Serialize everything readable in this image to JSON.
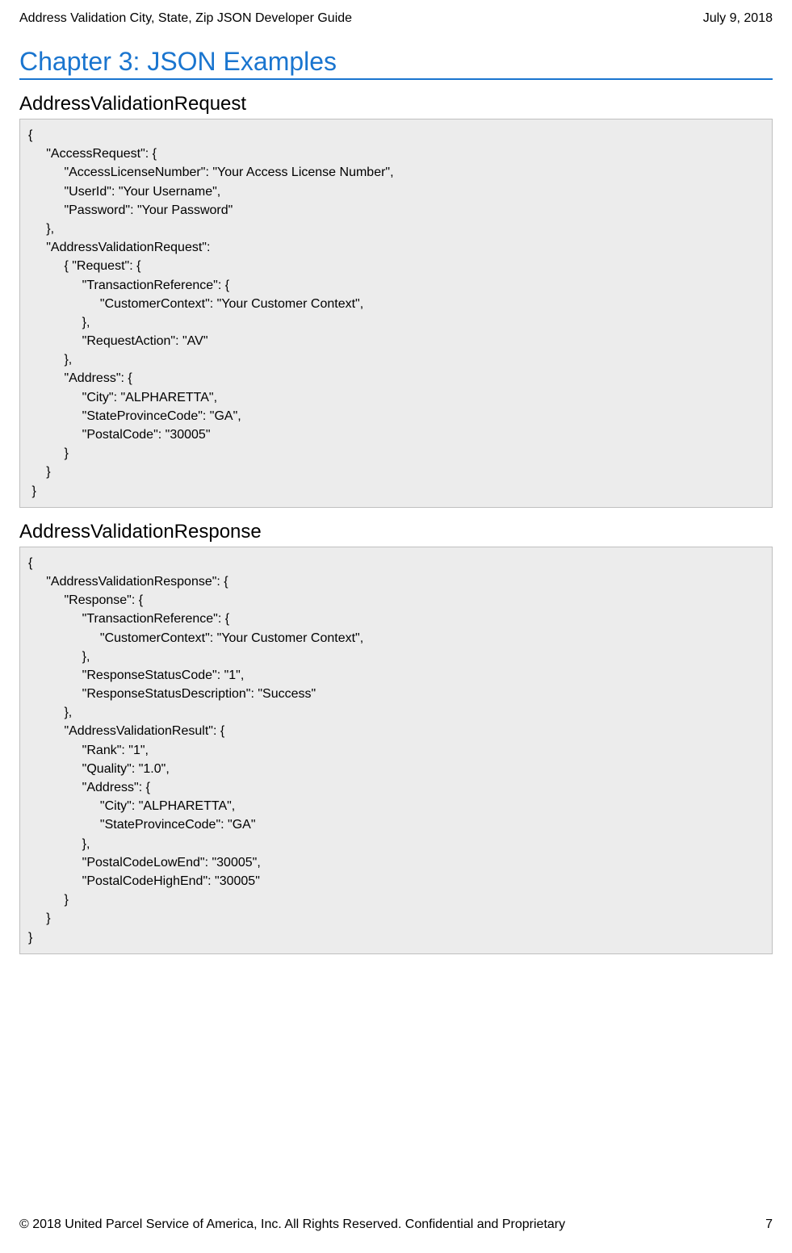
{
  "header": {
    "left": "Address Validation City, State, Zip JSON Developer Guide",
    "right": "July 9, 2018"
  },
  "chapter_title": "Chapter 3: JSON Examples",
  "section1_title": "AddressValidationRequest",
  "section2_title": "AddressValidationResponse",
  "code1": "{\n     \"AccessRequest\": {\n          \"AccessLicenseNumber\": \"Your Access License Number\",\n          \"UserId\": \"Your Username\",\n          \"Password\": \"Your Password\"\n     },\n     \"AddressValidationRequest\":\n          { \"Request\": {\n               \"TransactionReference\": {\n                    \"CustomerContext\": \"Your Customer Context\",\n               },\n               \"RequestAction\": \"AV\"\n          },\n          \"Address\": {\n               \"City\": \"ALPHARETTA\",\n               \"StateProvinceCode\": \"GA\",\n               \"PostalCode\": \"30005\"\n          }\n     }\n }",
  "code2": "{\n     \"AddressValidationResponse\": {\n          \"Response\": {\n               \"TransactionReference\": {\n                    \"CustomerContext\": \"Your Customer Context\",\n               },\n               \"ResponseStatusCode\": \"1\",\n               \"ResponseStatusDescription\": \"Success\"\n          },\n          \"AddressValidationResult\": {\n               \"Rank\": \"1\",\n               \"Quality\": \"1.0\",\n               \"Address\": {\n                    \"City\": \"ALPHARETTA\",\n                    \"StateProvinceCode\": \"GA\"\n               },\n               \"PostalCodeLowEnd\": \"30005\",\n               \"PostalCodeHighEnd\": \"30005\"\n          }\n     }\n}",
  "footer": {
    "left": "© 2018 United Parcel Service of America, Inc. All Rights Reserved. Confidential and Proprietary",
    "right": "7"
  }
}
